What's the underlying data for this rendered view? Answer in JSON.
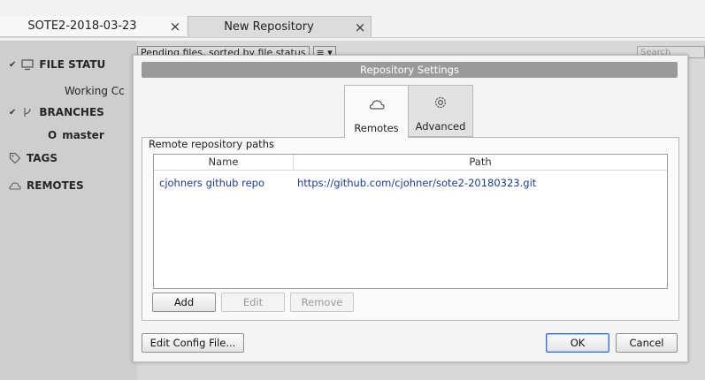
{
  "window_tabs": [
    {
      "label": "SOTE2-2018-03-23",
      "close": "×"
    },
    {
      "label": "New Repository",
      "close": "×"
    }
  ],
  "sidebar": {
    "file_status": "FILE STATU",
    "working_copy": "Working Cc",
    "branches": "BRANCHES",
    "master_marker": "O",
    "master": "master",
    "tags": "TAGS",
    "remotes": "REMOTES"
  },
  "toolbar": {
    "pending_files": "Pending files, sorted by file status",
    "view_menu": "≡ ▾",
    "search_placeholder": "Search"
  },
  "dialog": {
    "title": "Repository Settings",
    "tabs": {
      "remotes": "Remotes",
      "advanced": "Advanced"
    },
    "group_label": "Remote repository paths",
    "columns": {
      "name": "Name",
      "path": "Path"
    },
    "rows": [
      {
        "name": "cjohners github repo",
        "path": "https://github.com/cjohner/sote2-20180323.git"
      }
    ],
    "buttons": {
      "add": "Add",
      "edit": "Edit",
      "remove": "Remove",
      "edit_config": "Edit Config File...",
      "ok": "OK",
      "cancel": "Cancel"
    }
  },
  "colors": {
    "accent": "#3a6ec8",
    "link_text": "#1a3c8c",
    "title_bar": "#9a9a9a"
  }
}
